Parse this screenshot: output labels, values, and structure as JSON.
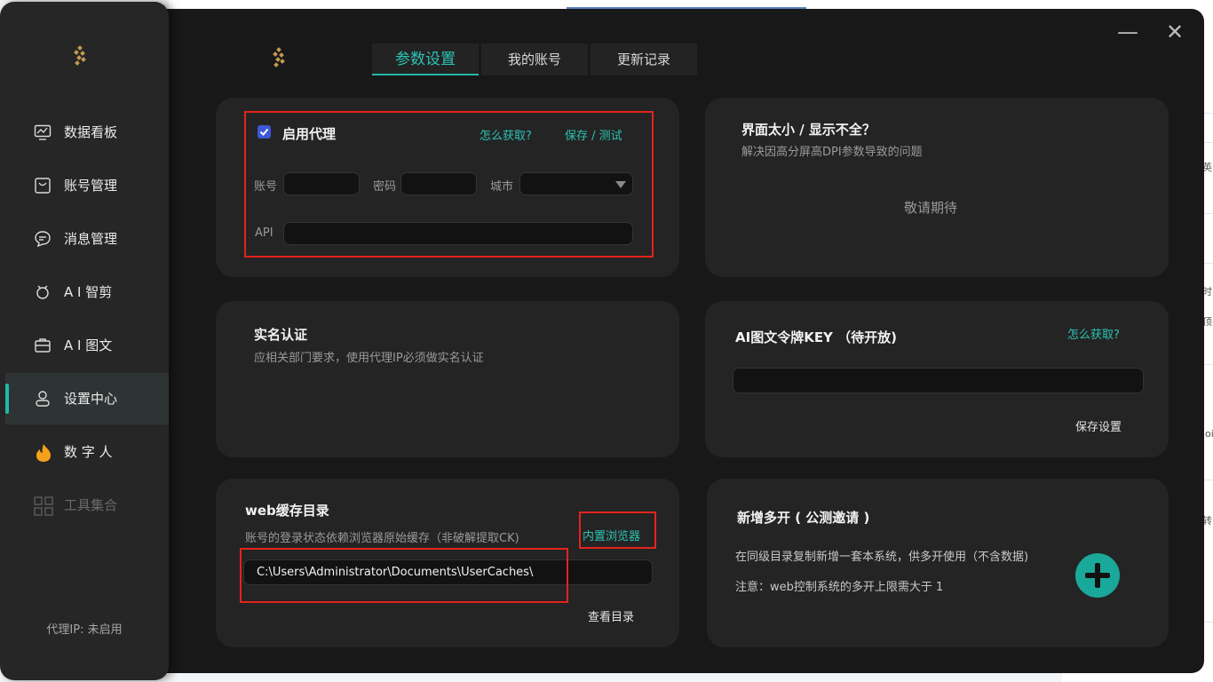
{
  "sidebar": {
    "items": [
      {
        "label": "数据看板",
        "icon": "dashboard-icon"
      },
      {
        "label": "账号管理",
        "icon": "bag-icon"
      },
      {
        "label": "消息管理",
        "icon": "chat-icon"
      },
      {
        "label": "A I 智剪",
        "icon": "scissors-icon"
      },
      {
        "label": "A I 图文",
        "icon": "briefcase-icon"
      },
      {
        "label": "设置中心",
        "icon": "settings-icon"
      },
      {
        "label": "数 字 人",
        "icon": "flame-icon"
      },
      {
        "label": "工具集合",
        "icon": "grid-icon"
      }
    ],
    "active": "设置中心",
    "proxy_ip": "代理IP: 未启用"
  },
  "tabs": [
    {
      "label": "参数设置"
    },
    {
      "label": "我的账号"
    },
    {
      "label": "更新记录"
    }
  ],
  "window": {
    "minimize": "—",
    "close": "✕"
  },
  "proxy_card": {
    "enable_label": "启用代理",
    "enabled": true,
    "how_to_get": "怎么获取?",
    "save_test": "保存 / 测试",
    "account_label": "账号",
    "account_value": "",
    "password_label": "密码",
    "password_value": "",
    "city_label": "城市",
    "city_value": "",
    "api_label": "API",
    "api_value": ""
  },
  "display_card": {
    "title": "界面太小 / 显示不全？",
    "subtitle": "解决因高分屏高DPI参数导致的问题",
    "coming_soon": "敬请期待"
  },
  "realname_card": {
    "title": "实名认证",
    "subtitle": "应相关部门要求，使用代理IP必须做实名认证"
  },
  "ai_key_card": {
    "title": "AI图文令牌KEY （待开放)",
    "how_to_get": "怎么获取?",
    "key_value": "",
    "save_label": "保存设置"
  },
  "web_cache_card": {
    "title": "web缓存目录",
    "subtitle": "账号的登录状态依赖浏览器原始缓存（非破解提取CK)",
    "builtin_browser": "内置浏览器",
    "path_value": "C:\\Users\\Administrator\\Documents\\UserCaches\\",
    "view_dir": "查看目录"
  },
  "multi_card": {
    "title": "新增多开 ( 公测邀请 )",
    "desc": "在同级目录复制新增一套本系统，供多开使用（不含数据)",
    "note": "注意：web控制系统的多开上限需大于 1"
  },
  "background": {
    "fragments": [
      "英",
      "时",
      "顶",
      "loi",
      "转"
    ]
  },
  "colors": {
    "accent": "#20b9a8",
    "highlight_box": "#e3231d",
    "checkbox": "#3d58d6",
    "logo": "#c79a52"
  }
}
